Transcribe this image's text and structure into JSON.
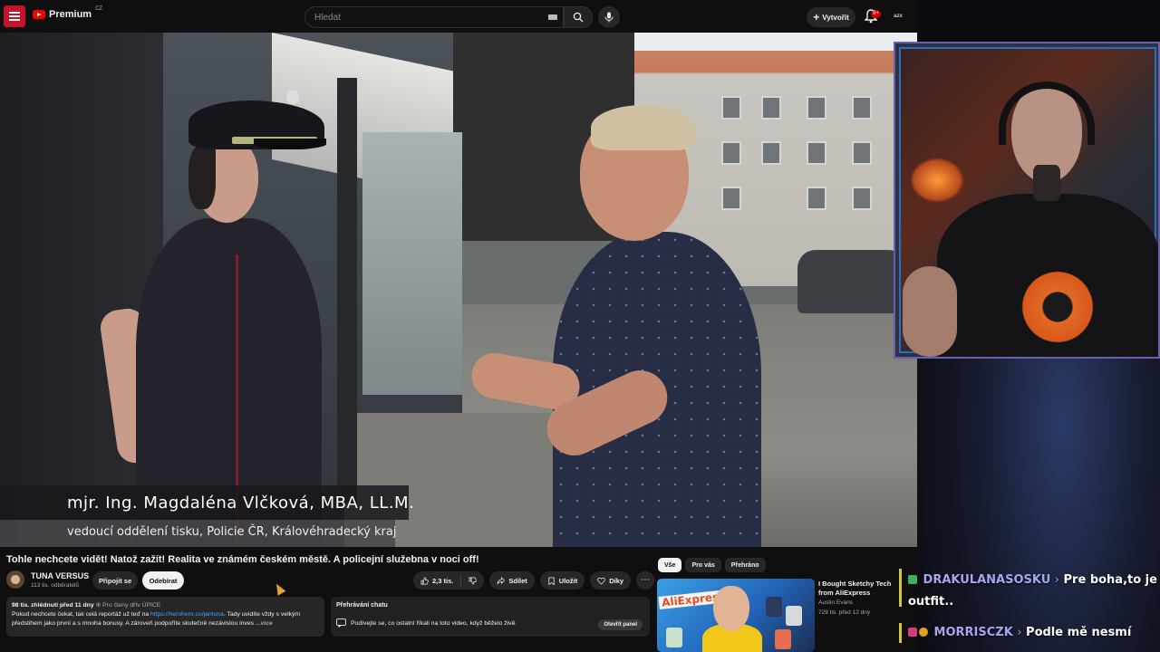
{
  "header": {
    "logo_text": "Premium",
    "logo_region": "CZ",
    "search_placeholder": "Hledat",
    "create_label": "Vytvořit",
    "notifications_badge": "9+",
    "account_label": "azx"
  },
  "video": {
    "lower_third_name": "mjr. Ing. Magdaléna Vlčková, MBA, LL.M.",
    "lower_third_role": "vedoucí oddělení tisku, Policie ČR, Královéhradecký kraj"
  },
  "watch": {
    "title": "Tohle nechcete vidět! Natož zažít! Realita ve známém českém městě. A policejní služebna v noci off!",
    "channel_name": "TUNA VERSUS",
    "channel_subs": "113 tis. odběratelů",
    "join_label": "Připojit se",
    "subscribe_label": "Odebírat",
    "like_count": "2,3 tis.",
    "share_label": "Sdílet",
    "save_label": "Uložit",
    "thanks_label": "Díky",
    "more_label": "⋯"
  },
  "description": {
    "meta": "98 tis. zhlédnutí  před 11 dny",
    "members": "⊕ Pro členy dřív  ÚPICE",
    "text_before_link": "Pokud nechcete čekat, tak celá reportáž už teď na ",
    "link": "https://herohero.co/jantuna",
    "text_after_link": ". Tady uvidíte vždy s velkým předstihem jako první a s mnoha bonusy. A zároveň podpoříte skutečně nezávislou inves",
    "more": "...více"
  },
  "chat_replay": {
    "title": "Přehrávání chatu",
    "text": "Podívejte se, co ostatní říkali na toto video, když běželo živě.",
    "button": "Otevřít panel"
  },
  "recommendations": {
    "chips": [
      "Vše",
      "Pro vás",
      "Přehráno"
    ],
    "item": {
      "thumb_text": "AliExpress",
      "title": "I Bought Sketchy Tech from AliExpress",
      "channel": "Austin Evans",
      "meta": "728 tis.  před 12 dny"
    }
  },
  "stream_chat": [
    {
      "user": "DRAKULANASOSKU",
      "separator": "›",
      "text": "Pre boha,to je outfit.."
    },
    {
      "user": "MORRISCZK",
      "separator": "›",
      "text": "Podle mě nesmí"
    }
  ],
  "colors": {
    "yt_red": "#ff0000",
    "chat_user": "#a9a6f0",
    "link": "#3ea6ff"
  }
}
